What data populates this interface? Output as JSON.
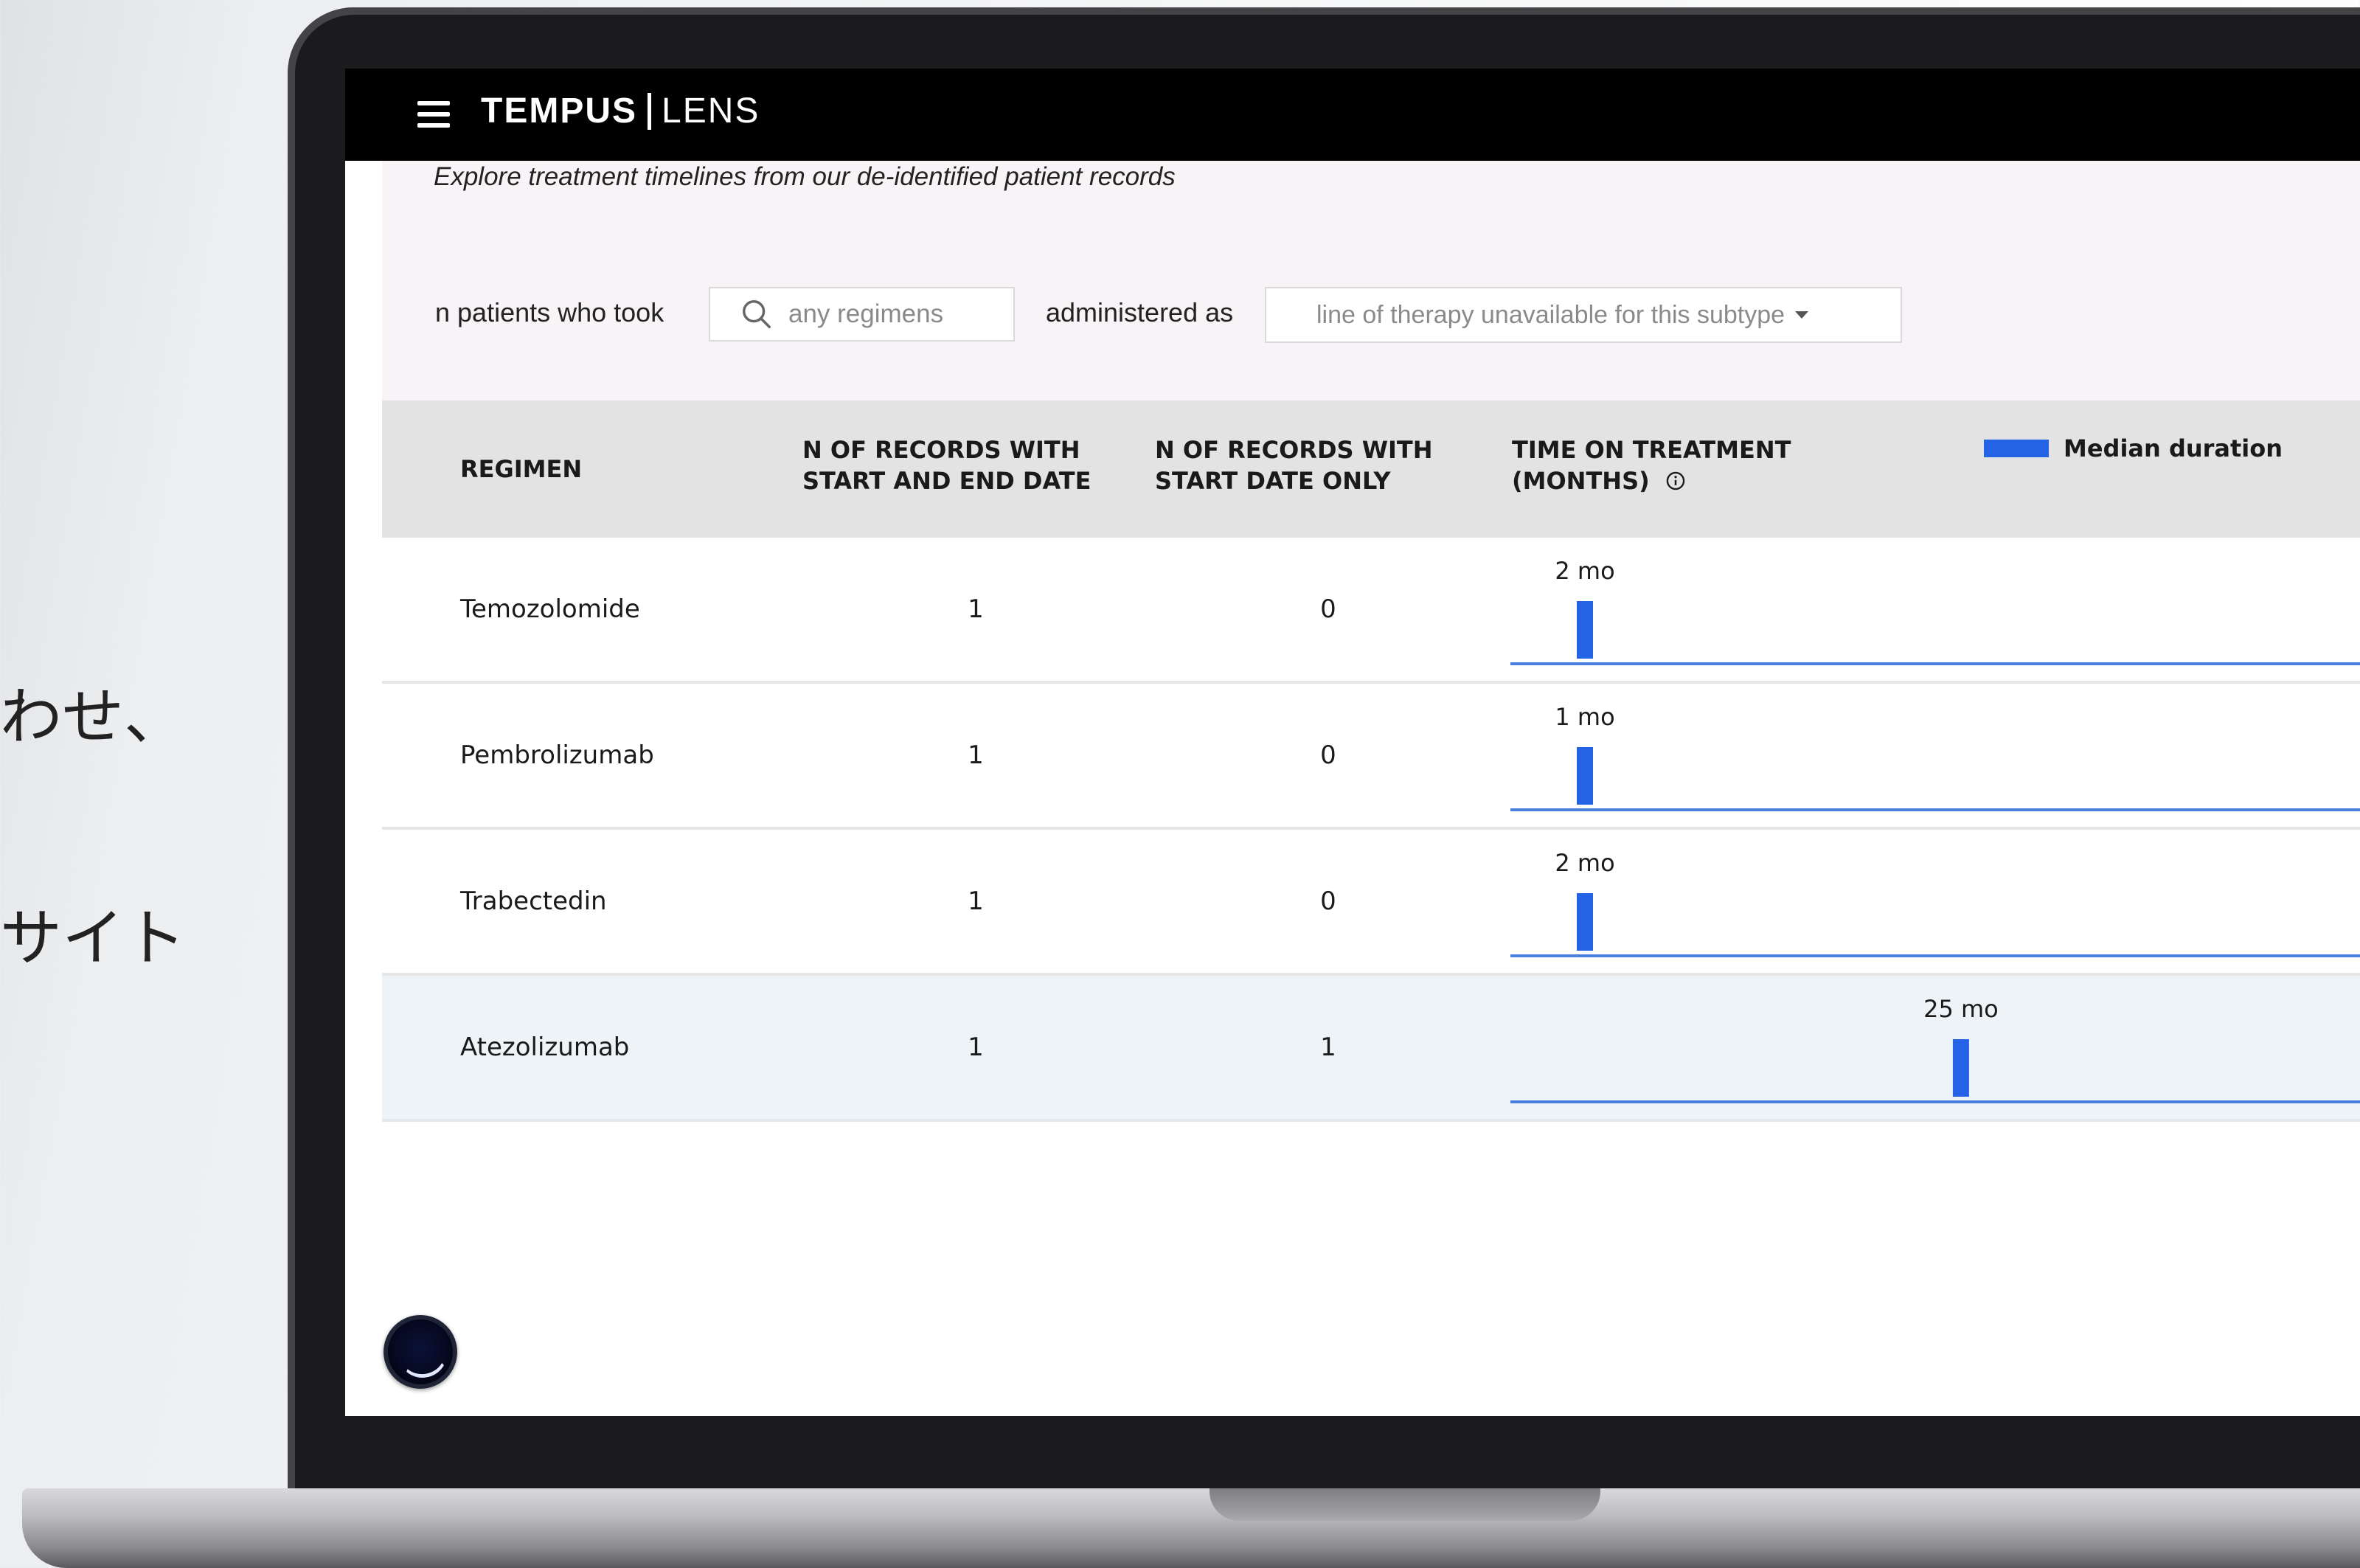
{
  "side_text": [
    "わせ、",
    "サイト"
  ],
  "app": {
    "brand_primary": "TEMPUS",
    "brand_secondary": "LENS",
    "subtitle": "Explore treatment timelines from our de-identified patient records"
  },
  "filters": {
    "label_1": "n patients who took",
    "search_placeholder": "any regimens",
    "label_2": "administered as",
    "therapy_value": "line of therapy unavailable for this subtype"
  },
  "table": {
    "headers": {
      "regimen": "REGIMEN",
      "both_line1": "N OF RECORDS WITH",
      "both_line2": "START AND END DATE",
      "start_line1": "N OF RECORDS WITH",
      "start_line2": "START DATE ONLY",
      "time_line1": "TIME ON TREATMENT",
      "time_line2": "(MONTHS)"
    },
    "legend_label": "Median duration",
    "rows": [
      {
        "regimen": "Temozolomide",
        "start_and_end": "1",
        "start_only": "0",
        "median_label": "2 mo",
        "median_months": 2
      },
      {
        "regimen": "Pembrolizumab",
        "start_and_end": "1",
        "start_only": "0",
        "median_label": "1 mo",
        "median_months": 1
      },
      {
        "regimen": "Trabectedin",
        "start_and_end": "1",
        "start_only": "0",
        "median_label": "2 mo",
        "median_months": 2
      },
      {
        "regimen": "Atezolizumab",
        "start_and_end": "1",
        "start_only": "1",
        "median_label": "25 mo",
        "median_months": 25
      }
    ]
  },
  "colors": {
    "accent": "#2563e6",
    "header_bg": "#000000",
    "table_header_bg": "#e3e3e3",
    "highlight_row": "#eef3f8"
  },
  "icons": {
    "menu": "menu-icon",
    "search": "search-icon",
    "caret": "caret-down-icon",
    "info": "info-icon",
    "chat": "chat-widget-icon"
  }
}
